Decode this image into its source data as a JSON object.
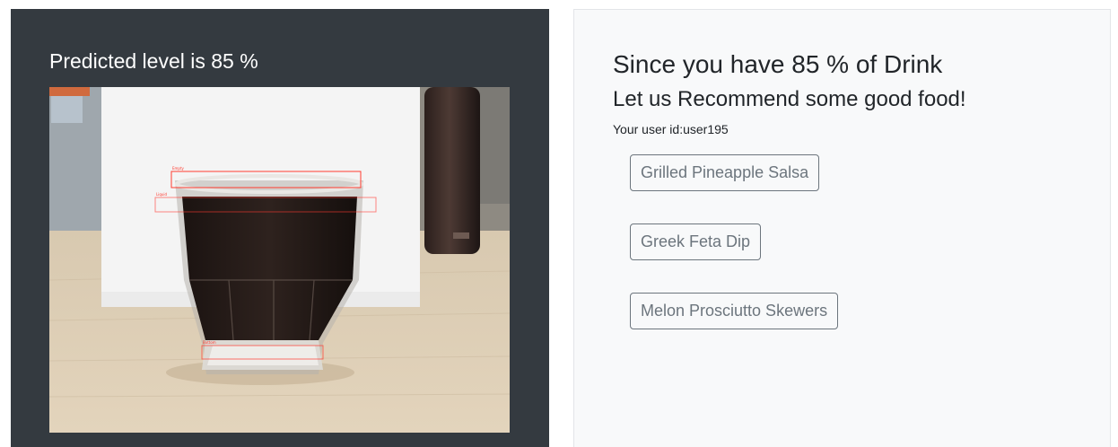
{
  "prediction": {
    "title": "Predicted level is 85 %",
    "level_percent": 85,
    "box_labels": [
      "Empty",
      "Liquid",
      "Bottom"
    ]
  },
  "recommend": {
    "heading": "Since you have 85 % of Drink",
    "subheading": "Let us Recommend some good food!",
    "user_line": "Your user id:user195",
    "foods": [
      "Grilled Pineapple Salsa",
      "Greek Feta Dip",
      "Melon Prosciutto Skewers"
    ]
  },
  "colors": {
    "dark_panel": "#343a40",
    "light_panel": "#f8f9fa",
    "button_outline": "#6c757d",
    "detection_box": "#ff3b30"
  }
}
